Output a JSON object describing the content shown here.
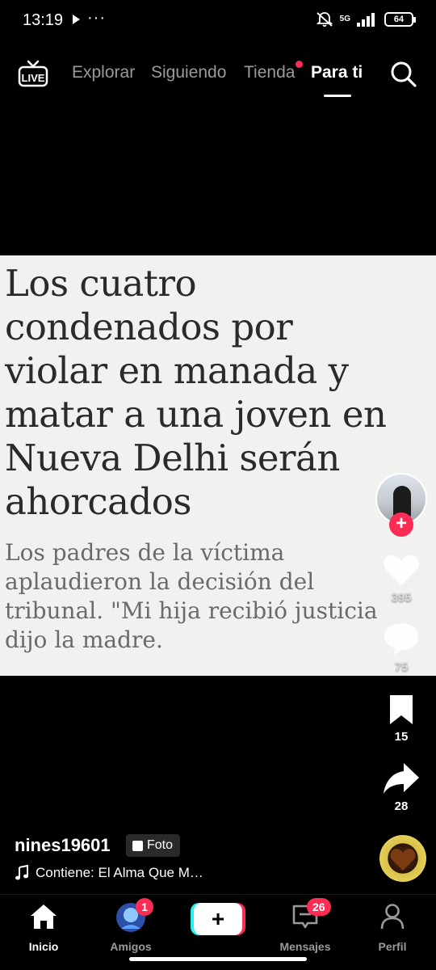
{
  "status_bar": {
    "time": "13:19",
    "more": "···",
    "network": "5G",
    "battery": "64"
  },
  "top_nav": {
    "live_label": "LIVE",
    "tabs": [
      {
        "label": "Explorar",
        "active": false
      },
      {
        "label": "Siguiendo",
        "active": false
      },
      {
        "label": "Tienda",
        "active": false,
        "has_dot": true
      },
      {
        "label": "Para ti",
        "active": true
      }
    ],
    "search_icon": "search-icon"
  },
  "post": {
    "headline": "Los cuatro\ncondenados por\nviolar en manada y\nmatar a una joven en\nNueva Delhi serán\nahorcados",
    "subhead": "Los padres de la víctima\naplaudieron la decisión del\ntribunal. \"Mi hija recibió justicia\ndijo la madre.",
    "author": "nines19601",
    "type_badge": "Foto",
    "music": "Contiene: El Alma Que M…"
  },
  "actions": {
    "likes": "395",
    "comments": "75",
    "saves": "15",
    "shares": "28"
  },
  "bottom_nav": {
    "items": [
      {
        "label": "Inicio",
        "active": true
      },
      {
        "label": "Amigos",
        "active": false,
        "badge": "1"
      },
      {
        "label": "",
        "active": false
      },
      {
        "label": "Mensajes",
        "active": false,
        "badge": "26"
      },
      {
        "label": "Perfil",
        "active": false
      }
    ]
  },
  "colors": {
    "accent": "#fe2c55",
    "accent_cyan": "#25f4ee",
    "background": "#000000"
  }
}
